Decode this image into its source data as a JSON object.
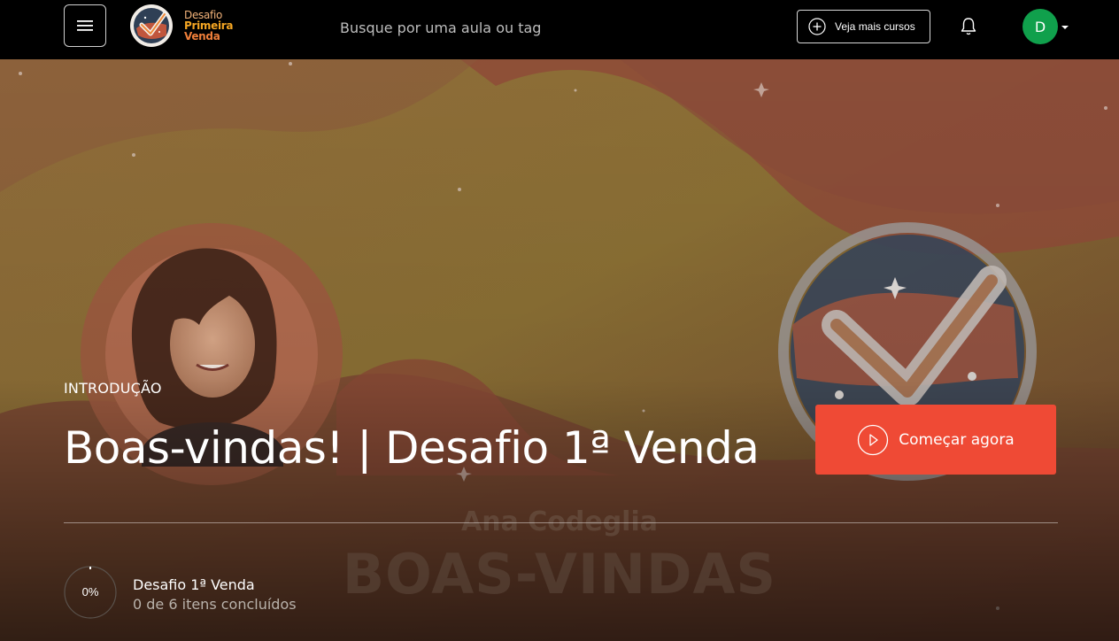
{
  "header": {
    "menu_icon": "hamburger-icon",
    "logo": {
      "line1": "Desafio",
      "line2": "Primeira",
      "line3": "Venda",
      "colors": [
        "#f2b37a",
        "#f5a623",
        "#f07f3a"
      ]
    },
    "search": {
      "placeholder": "Busque por uma aula ou tag",
      "value": ""
    },
    "more_courses_label": "Veja mais cursos",
    "more_courses_icon": "plus-circle-icon",
    "notifications_icon": "bell-icon",
    "user_avatar_initial": "D",
    "avatar_color": "#10a04c"
  },
  "hero": {
    "kicker": "INTRODUÇÃO",
    "title": "Boas-vindas! | Desafio 1ª Venda",
    "start_button_label": "Começar agora",
    "start_button_icon": "play-circle-icon",
    "accent_color": "#ef4a35",
    "watermark_name": "Ana Codeglia",
    "watermark_text": "BOAS-VINDAS"
  },
  "progress": {
    "percent_label": "0%",
    "percent": 0,
    "course_title": "Desafio 1ª Venda",
    "completed_text": "0 de 6 itens concluídos"
  }
}
